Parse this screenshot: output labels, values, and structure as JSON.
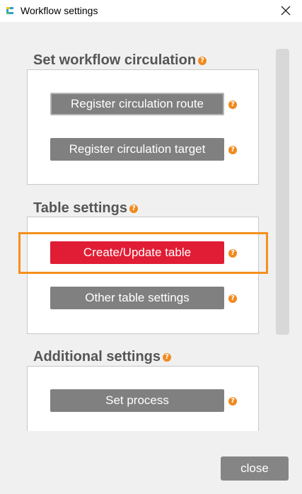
{
  "window": {
    "title": "Workflow settings"
  },
  "sections": {
    "circulation": {
      "title": "Set workflow circulation",
      "buttons": [
        "Register circulation route",
        "Register circulation target"
      ]
    },
    "table": {
      "title": "Table settings",
      "buttons": [
        "Create/Update table",
        "Other table settings"
      ]
    },
    "additional": {
      "title": "Additional settings",
      "buttons": [
        "Set process"
      ]
    }
  },
  "help_glyph": "?",
  "footer": {
    "close_label": "close"
  },
  "colors": {
    "accent_red": "#e11d35",
    "highlight_orange": "#f5901e",
    "help_orange": "#f08a1e",
    "button_gray": "#808080"
  },
  "icons": [
    "app-logo-icon",
    "close-icon",
    "help-icon"
  ]
}
